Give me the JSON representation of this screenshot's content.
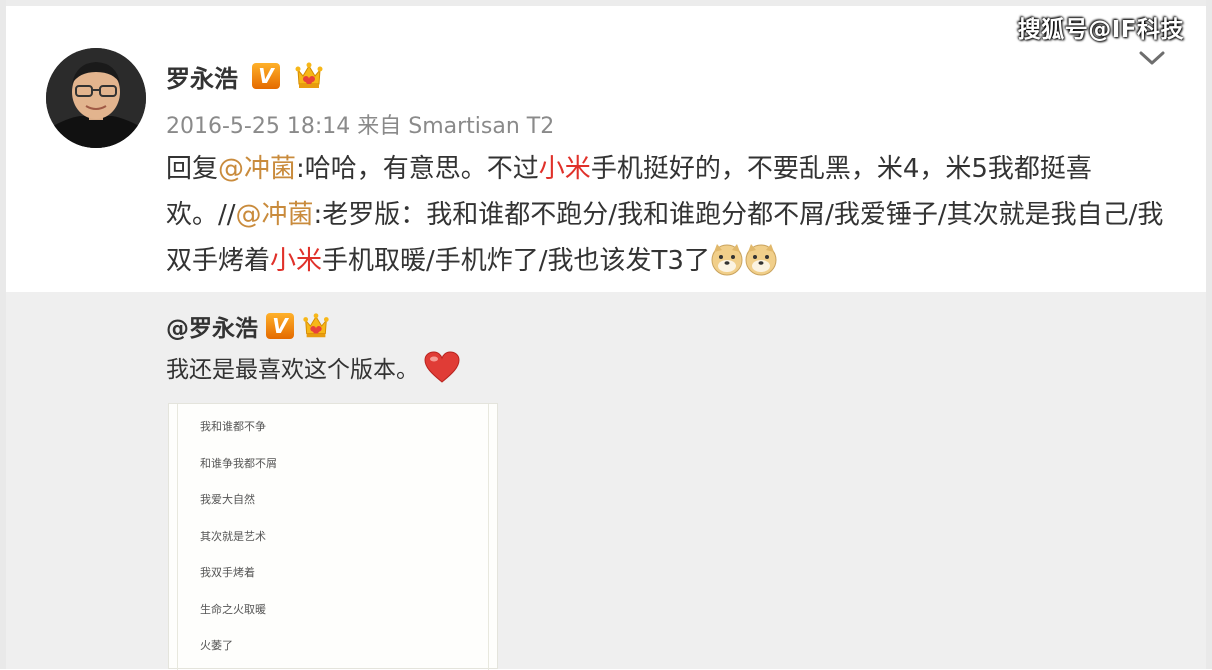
{
  "watermark": "搜狐号@IF科技",
  "post": {
    "author": "罗永浩",
    "verified_badge": "V",
    "meta": "2016-5-25 18:14 来自 Smartisan T2",
    "segments": [
      {
        "t": "回复",
        "s": "n"
      },
      {
        "t": "@冲菌",
        "s": "at"
      },
      {
        "t": ":哈哈，有意思。不过",
        "s": "n"
      },
      {
        "t": "小米",
        "s": "red"
      },
      {
        "t": "手机挺好的，不要乱黑，米4，米5我都挺喜欢。//",
        "s": "n"
      },
      {
        "t": "@冲菌",
        "s": "at"
      },
      {
        "t": ":老罗版：我和谁都不跑分/我和谁跑分都不屑/我爱锤子/其次就是我自己/我双手烤着",
        "s": "n"
      },
      {
        "t": "小米",
        "s": "red"
      },
      {
        "t": "手机取暖/手机炸了/我也该发T3了",
        "s": "n"
      }
    ],
    "emojis": [
      "doge-emoji",
      "doge-emoji"
    ]
  },
  "quoted": {
    "author": "@罗永浩",
    "verified_badge": "V",
    "text": "我还是最喜欢这个版本。",
    "emoji": "heart-emoji",
    "image_lines": [
      "我和谁都不争",
      "和谁争我都不屑",
      "我爱大自然",
      "其次就是艺术",
      "我双手烤着",
      "生命之火取暖",
      "火萎了"
    ]
  },
  "icons": {
    "chevron": "chevron-down-icon",
    "crown": "vip-crown-icon"
  },
  "colors": {
    "mention": "#c98b3c",
    "highlight": "#e0312a",
    "meta": "#8a8a8a",
    "quote_bg": "#efefef"
  }
}
